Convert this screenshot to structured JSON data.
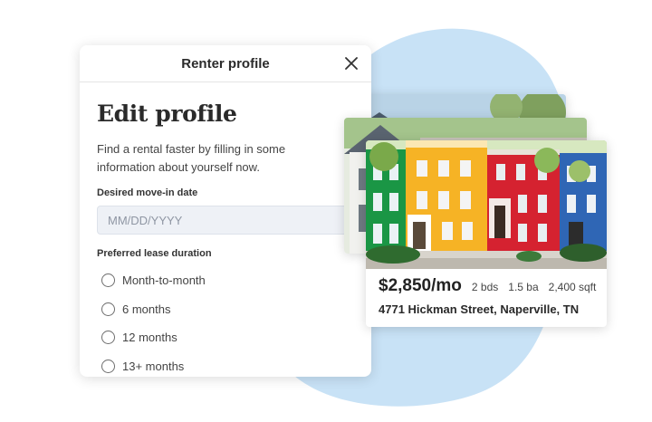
{
  "modal": {
    "title": "Renter profile",
    "close_icon": "close-icon",
    "heading": "Edit profile",
    "intro": "Find a rental faster by filling in some information about yourself now.",
    "move_in": {
      "label": "Desired move-in date",
      "placeholder": "MM/DD/YYYY"
    },
    "lease": {
      "label": "Preferred lease duration",
      "options": [
        "Month-to-month",
        "6 months",
        "12 months",
        "13+ months"
      ],
      "selected": null
    }
  },
  "listing": {
    "price": "$2,850/mo",
    "beds": "2 bds",
    "baths": "1.5 ba",
    "sqft": "2,400 sqft",
    "address": "4771 Hickman Street, Naperville, TN"
  },
  "colors": {
    "accent_blob": "#c8e2f6",
    "input_background": "#eef1f6",
    "house_green": "#1a9645",
    "house_yellow": "#f6b325",
    "house_red": "#d52230",
    "house_blue": "#2f66b5"
  }
}
